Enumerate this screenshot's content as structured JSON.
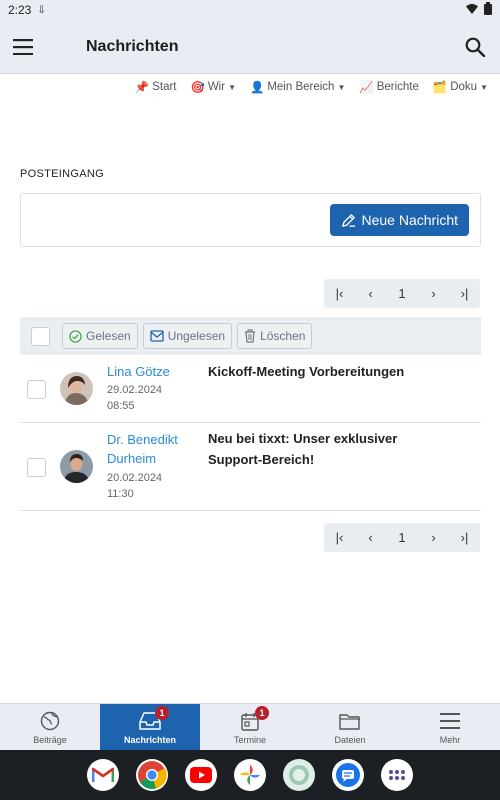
{
  "status": {
    "time": "2:23"
  },
  "app": {
    "title": "Nachrichten"
  },
  "topnav": [
    {
      "icon": "📌",
      "label": "Start",
      "caret": false
    },
    {
      "icon": "🎯",
      "label": "Wir",
      "caret": true
    },
    {
      "icon": "👤",
      "label": "Mein Bereich",
      "caret": true
    },
    {
      "icon": "📈",
      "label": "Berichte",
      "caret": false
    },
    {
      "icon": "🗂️",
      "label": "Doku",
      "caret": true
    }
  ],
  "inbox": {
    "label": "POSTEINGANG",
    "compose_label": "Neue Nachricht",
    "page": "1",
    "actions": {
      "read": "Gelesen",
      "unread": "Ungelesen",
      "delete": "Löschen"
    },
    "messages": [
      {
        "sender": "Lina Götze",
        "date": "29.02.2024",
        "time": "08:55",
        "subject": "Kickoff-Meeting Vorbereitungen"
      },
      {
        "sender": "Dr. Benedikt Durheim",
        "date": "20.02.2024",
        "time": "11:30",
        "subject": "Neu bei tixxt: Unser exklusiver Support-Bereich!"
      }
    ]
  },
  "bottomnav": [
    {
      "label": "Beiträge",
      "icon": "globe-icon",
      "badge": ""
    },
    {
      "label": "Nachrichten",
      "icon": "inbox-icon",
      "badge": "1"
    },
    {
      "label": "Termine",
      "icon": "calendar-icon",
      "badge": "1"
    },
    {
      "label": "Dateien",
      "icon": "folder-icon",
      "badge": ""
    },
    {
      "label": "Mehr",
      "icon": "menu-icon",
      "badge": ""
    }
  ],
  "dock": [
    "gmail-app",
    "chrome-app",
    "youtube-app",
    "photos-app",
    "mix-app",
    "messages-app",
    "all-apps"
  ],
  "colors": {
    "accent": "#1d63ae",
    "link": "#2a8cd3",
    "badge": "#b5202a",
    "bar": "#e9edf3"
  }
}
